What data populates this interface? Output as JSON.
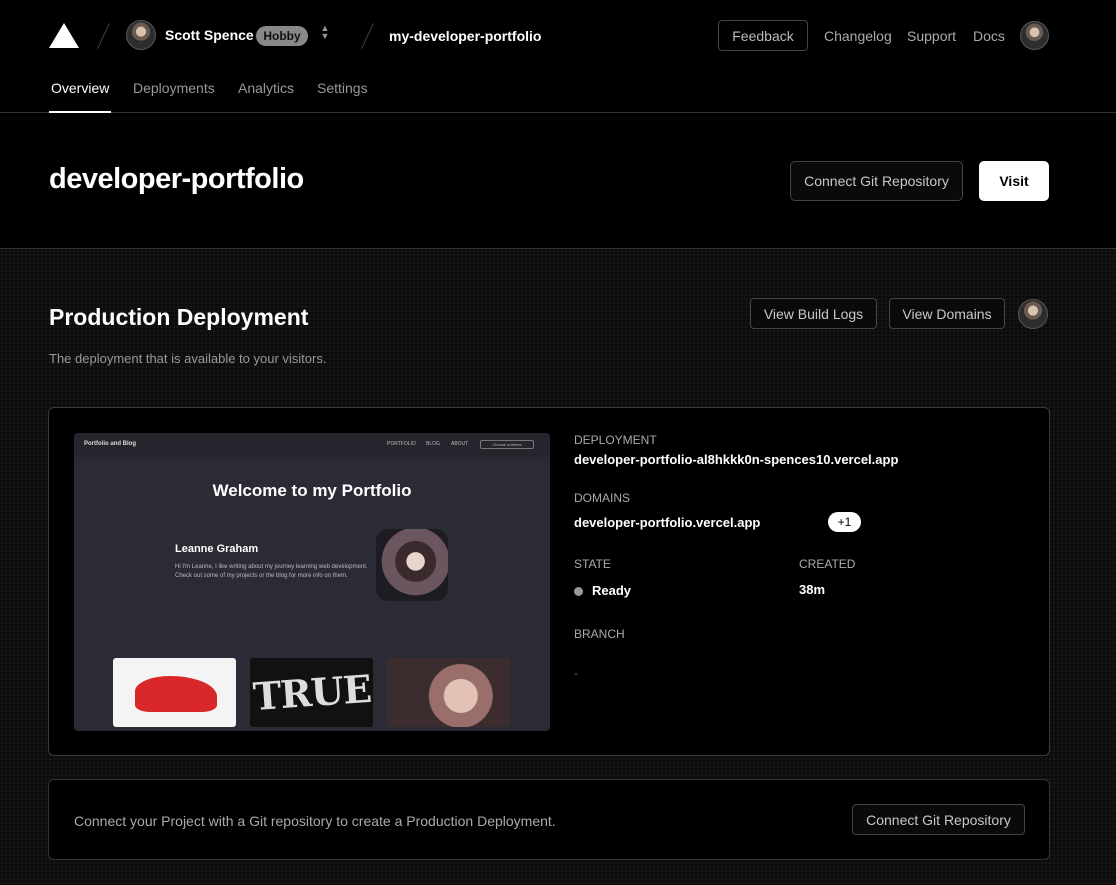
{
  "header": {
    "user_name": "Scott Spence",
    "plan": "Hobby",
    "project_crumb": "my-developer-portfolio",
    "feedback": "Feedback",
    "links": [
      "Changelog",
      "Support",
      "Docs"
    ]
  },
  "tabs": [
    {
      "label": "Overview",
      "active": true
    },
    {
      "label": "Deployments",
      "active": false
    },
    {
      "label": "Analytics",
      "active": false
    },
    {
      "label": "Settings",
      "active": false
    }
  ],
  "project": {
    "title": "developer-portfolio",
    "connect_git": "Connect Git Repository",
    "visit": "Visit"
  },
  "production": {
    "title": "Production Deployment",
    "subtitle": "The deployment that is available to your visitors.",
    "view_build_logs": "View Build Logs",
    "view_domains": "View Domains",
    "preview": {
      "brand": "Portfolio and Blog",
      "nav": [
        "PORTFOLIO",
        "BLOG",
        "ABOUT"
      ],
      "theme_button": "Choose a theme",
      "hero": "Welcome to my Portfolio",
      "name": "Leanne Graham",
      "bio": "Hi I'm Leanne, I like writing about my journey learning web development. Check out some of my projects or the blog for more info on them.",
      "thumb_text": "TRUE"
    },
    "deployment_label": "DEPLOYMENT",
    "deployment_url": "developer-portfolio-al8hkkk0n-spences10.vercel.app",
    "domains_label": "DOMAINS",
    "domain": "developer-portfolio.vercel.app",
    "domain_extra": "+1",
    "state_label": "STATE",
    "state": "Ready",
    "state_color": "#9a9a9a",
    "created_label": "CREATED",
    "created": "38m",
    "branch_label": "BRANCH",
    "branch": "-"
  },
  "git_prompt": {
    "text": "Connect your Project with a Git repository to create a Production Deployment.",
    "button": "Connect Git Repository"
  },
  "colors": {
    "background": "#000000",
    "accent": "#ffffff",
    "border": "#333333"
  }
}
